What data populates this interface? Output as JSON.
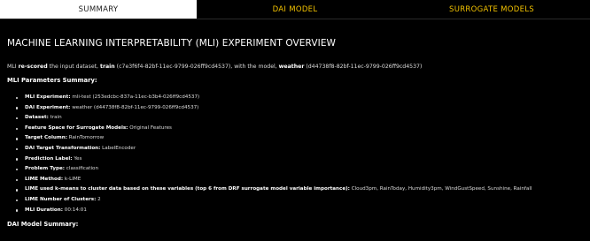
{
  "tabs": [
    {
      "label": "SUMMARY"
    },
    {
      "label": "DAI MODEL"
    },
    {
      "label": "SURROGATE MODELS"
    }
  ],
  "page_title": "MACHINE LEARNING INTERPRETABILITY (MLI) EXPERIMENT OVERVIEW",
  "intro": {
    "p1": "MLI ",
    "b1": "re-scored",
    "p2": " the input dataset, ",
    "b2": "train",
    "p3": " (c7e3f6f4-82bf-11ec-9799-026ff9cd4537), with the model, ",
    "b3": "weather",
    "p4": " (d44738f8-82bf-11ec-9799-026ff9cd4537)"
  },
  "params_heading": "MLI Parameters Summary:",
  "params": [
    {
      "label": "MLI Experiment:",
      "value": " mli-test (253edcbc-837a-11ec-b3b4-026ff9cd4537)"
    },
    {
      "label": "DAI Experiment:",
      "value": " weather (d44738f8-82bf-11ec-9799-026ff9cd4537)"
    },
    {
      "label": "Dataset:",
      "value": " train"
    },
    {
      "label": "Feature Space for Surrogate Models:",
      "value": " Original Features"
    },
    {
      "label": "Target Column:",
      "value": " RainTomorrow"
    },
    {
      "label": "DAI Target Transformation:",
      "value": " LabelEncoder"
    },
    {
      "label": "Prediction Label:",
      "value": " Yes"
    },
    {
      "label": "Problem Type:",
      "value": " classification"
    },
    {
      "label": "LIME Method:",
      "value": " k-LIME"
    },
    {
      "label": "LIME used k-means to cluster data based on these variables (top 6 from DRF surrogate model variable importance):",
      "value": " Cloud3pm, RainToday, Humidity3pm, WindGustSpeed, Sunshine, Rainfall"
    },
    {
      "label": "LIME Number of Clusters:",
      "value": " 2"
    },
    {
      "label": "MLI Duration:",
      "value": " 00:14:01"
    }
  ],
  "model_heading": "DAI Model Summary:"
}
